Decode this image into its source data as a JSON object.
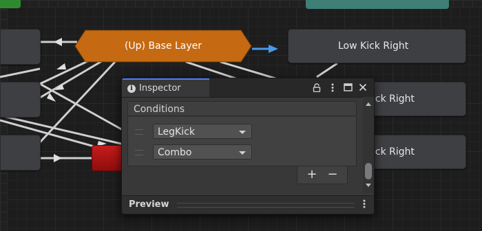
{
  "graph": {
    "base_layer_label": "(Up) Base Layer",
    "nodes": [
      {
        "label": "Low Kick Right"
      },
      {
        "label": "ick Right"
      },
      {
        "label": "ick Right"
      }
    ]
  },
  "inspector": {
    "tab_label": "Inspector",
    "section_title": "Conditions",
    "conditions": [
      {
        "parameter": "LegKick"
      },
      {
        "parameter": "Combo"
      }
    ],
    "add_symbol": "+",
    "remove_symbol": "−",
    "preview_label": "Preview",
    "icons": {
      "info": "i",
      "lock": "lock-icon",
      "menu": "more-icon",
      "maximize": "maximize-icon",
      "close": "close-icon",
      "preview_menu": "more-icon"
    }
  },
  "colors": {
    "base_layer": "#c56a12",
    "selected_state": "#b01515",
    "transition_highlight": "#4a9ae8",
    "tab_accent": "#4c7fff"
  }
}
